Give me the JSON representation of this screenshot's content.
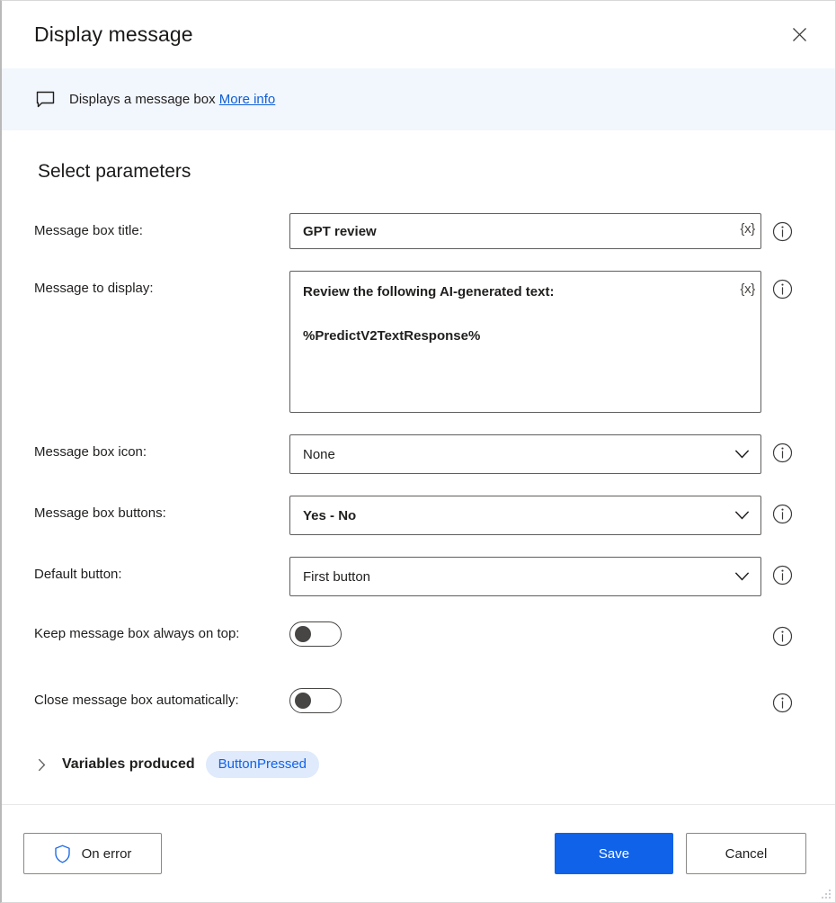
{
  "window": {
    "title": "Display message",
    "close_label": "Close",
    "close_icon": "close-icon",
    "resize_grip": "resize-grip"
  },
  "banner": {
    "icon": "message-bubble-icon",
    "text": "Displays a message box",
    "link_label": "More info"
  },
  "section": {
    "title": "Select parameters"
  },
  "fields": {
    "message_box_title": {
      "label": "Message box title:",
      "value": "GPT review",
      "variable_button": "{x}",
      "info_icon": "info-icon"
    },
    "message_to_display": {
      "label": "Message to display:",
      "value": "Review the following AI-generated text:\n\n%PredictV2TextResponse%",
      "variable_button": "{x}",
      "info_icon": "info-icon"
    },
    "message_box_icon": {
      "label": "Message box icon:",
      "value": "None",
      "chevron_icon": "chevron-down-icon",
      "info_icon": "info-icon"
    },
    "message_box_buttons": {
      "label": "Message box buttons:",
      "value": "Yes - No",
      "chevron_icon": "chevron-down-icon",
      "info_icon": "info-icon"
    },
    "default_button": {
      "label": "Default button:",
      "value": "First button",
      "chevron_icon": "chevron-down-icon",
      "info_icon": "info-icon"
    },
    "keep_always_on_top": {
      "label": "Keep message box always on top:",
      "state": "off",
      "info_icon": "info-icon"
    },
    "close_automatically": {
      "label": "Close message box automatically:",
      "state": "off",
      "info_icon": "info-icon"
    }
  },
  "variables_produced": {
    "caret_icon": "chevron-right-icon",
    "label": "Variables produced",
    "items": [
      {
        "name": "ButtonPressed"
      }
    ]
  },
  "footer": {
    "on_error_label": "On error",
    "on_error_icon": "shield-icon",
    "save_label": "Save",
    "cancel_label": "Cancel"
  },
  "colors": {
    "accent": "#1062e8",
    "banner_bg": "#f2f6fd",
    "link": "#0f5fd7",
    "pill_bg": "#dfeafc",
    "pill_text": "#1062e8",
    "border": "#605e5c",
    "text": "#201f1e"
  }
}
